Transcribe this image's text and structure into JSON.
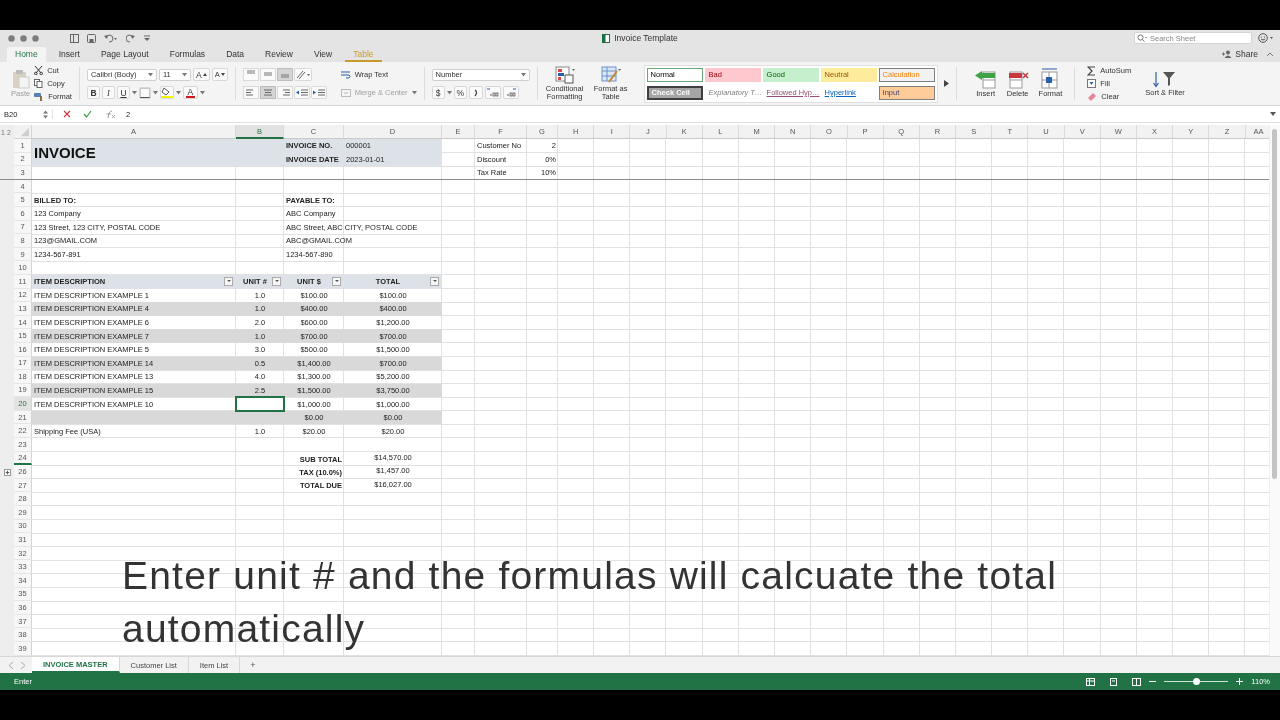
{
  "window": {
    "title": "Invoice Template",
    "search_placeholder": "Search Sheet",
    "share": "Share"
  },
  "tabs": [
    {
      "label": "Home",
      "selected": true,
      "kind": "standard"
    },
    {
      "label": "Insert",
      "selected": false,
      "kind": "standard"
    },
    {
      "label": "Page Layout",
      "selected": false,
      "kind": "standard"
    },
    {
      "label": "Formulas",
      "selected": false,
      "kind": "standard"
    },
    {
      "label": "Data",
      "selected": false,
      "kind": "standard"
    },
    {
      "label": "Review",
      "selected": false,
      "kind": "standard"
    },
    {
      "label": "View",
      "selected": false,
      "kind": "standard"
    },
    {
      "label": "Table",
      "selected": false,
      "kind": "contextual"
    }
  ],
  "ribbon": {
    "paste": {
      "label": "Paste",
      "disabled": true
    },
    "cut": "Cut",
    "copy": "Copy",
    "format_painter": "Format",
    "font": {
      "name": "Calibri (Body)",
      "size": "11",
      "grow": "A",
      "shrink": "A",
      "bold": "B",
      "italic": "I",
      "underline": "U",
      "color_letter": "A"
    },
    "vertical_align": [
      {
        "selected": false
      },
      {
        "selected": false
      },
      {
        "selected": true
      }
    ],
    "horizontal_align": [
      {
        "selected": false
      },
      {
        "selected": true
      },
      {
        "selected": false
      }
    ],
    "wrap_text": {
      "label": "Wrap Text",
      "disabled": false
    },
    "merge": {
      "label": "Merge & Center",
      "disabled": true
    },
    "number_format": "Number",
    "currency": "$",
    "percent": "%",
    "conditional_formatting": "Conditional Formatting",
    "format_as_table": "Format as Table",
    "cell_styles": [
      {
        "label": "Normal",
        "kind": "normal",
        "selected": true
      },
      {
        "label": "Bad",
        "kind": "bad",
        "selected": false
      },
      {
        "label": "Good",
        "kind": "good",
        "selected": false
      },
      {
        "label": "Neutral",
        "kind": "neutral",
        "selected": false
      },
      {
        "label": "Calculation",
        "kind": "calculation",
        "selected": false
      },
      {
        "label": "Check Cell",
        "kind": "check",
        "selected": false
      },
      {
        "label": "Explanatory T…",
        "kind": "explanatory",
        "selected": false
      },
      {
        "label": "Followed Hyp…",
        "kind": "followed",
        "selected": false
      },
      {
        "label": "Hyperlink",
        "kind": "hyperlink",
        "selected": false
      },
      {
        "label": "Input",
        "kind": "input",
        "selected": false
      }
    ],
    "cells": [
      {
        "label": "Insert",
        "kind": "insert"
      },
      {
        "label": "Delete",
        "kind": "delete"
      },
      {
        "label": "Format",
        "kind": "format"
      }
    ],
    "autosum": "AutoSum",
    "fill": "Fill",
    "clear": "Clear",
    "sort_filter": "Sort & Filter"
  },
  "formula_bar": {
    "name_box": "B20",
    "formula": "2"
  },
  "sheet": {
    "outline_levels": [
      "1",
      "2"
    ],
    "columns": [
      "A",
      "B",
      "C",
      "D",
      "E",
      "F",
      "G",
      "H",
      "I",
      "J",
      "K",
      "L",
      "M",
      "N",
      "O",
      "P",
      "Q",
      "R",
      "S",
      "T",
      "U",
      "V",
      "W",
      "X",
      "Y",
      "Z",
      "AA"
    ],
    "row_numbers": [
      "1",
      "2",
      "3",
      "4",
      "5",
      "6",
      "7",
      "8",
      "9",
      "10",
      "11",
      "12",
      "13",
      "14",
      "15",
      "16",
      "17",
      "18",
      "19",
      "20",
      "21",
      "22",
      "23",
      "24",
      "26",
      "27",
      "28",
      "29",
      "30",
      "31",
      "32",
      "33",
      "34",
      "35",
      "36",
      "37",
      "38",
      "39"
    ],
    "header": {
      "title": "INVOICE",
      "fields": [
        {
          "label": "INVOICE NO.",
          "value": "000001"
        },
        {
          "label": "INVOICE DATE",
          "value": "2023-01-01"
        }
      ]
    },
    "billed_to": {
      "label": "BILLED TO:",
      "lines": [
        "123 Company",
        "123 Street, 123 CITY, POSTAL CODE",
        "123@GMAIL.COM",
        "1234-567-891"
      ]
    },
    "payable_to": {
      "label": "PAYABLE TO:",
      "lines": [
        "ABC Company",
        "ABC Street,  ABC CITY, POSTAL CODE",
        "ABC@GMAIL.COM",
        "1234-567-890"
      ]
    },
    "items": {
      "columns": [
        {
          "label": "ITEM DESCRIPTION"
        },
        {
          "label": "UNIT #"
        },
        {
          "label": "UNIT $"
        },
        {
          "label": "TOTAL"
        }
      ],
      "rows": [
        {
          "description": "ITEM DESCRIPTION EXAMPLE 1",
          "units": "1.0",
          "unit_price": "$100.00",
          "total": "$100.00",
          "selected": false
        },
        {
          "description": "ITEM DESCRIPTION EXAMPLE 4",
          "units": "1.0",
          "unit_price": "$400.00",
          "total": "$400.00",
          "selected": false
        },
        {
          "description": "ITEM DESCRIPTION EXAMPLE 6",
          "units": "2.0",
          "unit_price": "$600.00",
          "total": "$1,200.00",
          "selected": false
        },
        {
          "description": "ITEM DESCRIPTION EXAMPLE 7",
          "units": "1.0",
          "unit_price": "$700.00",
          "total": "$700.00",
          "selected": false
        },
        {
          "description": "ITEM DESCRIPTION EXAMPLE 5",
          "units": "3.0",
          "unit_price": "$500.00",
          "total": "$1,500.00",
          "selected": false
        },
        {
          "description": "ITEM DESCRIPTION EXAMPLE 14",
          "units": "0.5",
          "unit_price": "$1,400.00",
          "total": "$700.00",
          "selected": false
        },
        {
          "description": "ITEM DESCRIPTION EXAMPLE 13",
          "units": "4.0",
          "unit_price": "$1,300.00",
          "total": "$5,200.00",
          "selected": false
        },
        {
          "description": "ITEM DESCRIPTION EXAMPLE 15",
          "units": "2.5",
          "unit_price": "$1,500.00",
          "total": "$3,750.00",
          "selected": false
        },
        {
          "description": "ITEM DESCRIPTION EXAMPLE 10",
          "unit_price": "$1,000.00",
          "total": "$1,000.00",
          "selected": true
        },
        {
          "unit_price": "$0.00",
          "total": "$0.00",
          "selected": false
        },
        {
          "description": "Shipping Fee (USA)",
          "units": "1.0",
          "unit_price": "$20.00",
          "total": "$20.00",
          "selected": false
        }
      ]
    },
    "totals": [
      {
        "label": "SUB TOTAL",
        "value": "$14,570.00"
      },
      {
        "label": "TAX (10.0%)",
        "value": "$1,457.00"
      },
      {
        "label": "TOTAL DUE",
        "value": "$16,027.00"
      }
    ],
    "settings": [
      {
        "label": "Customer No",
        "value": "2"
      },
      {
        "label": "Discount",
        "value": "0%"
      },
      {
        "label": "Tax Rate",
        "value": "10%"
      }
    ]
  },
  "caption": "Enter unit # and the formulas will calcuate the total automatically",
  "sheet_tabs": [
    {
      "label": "INVOICE MASTER",
      "selected": true
    },
    {
      "label": "Customer List",
      "selected": false
    },
    {
      "label": "Item List",
      "selected": false
    }
  ],
  "add_sheet": "+",
  "status_bar": {
    "mode": "Enter",
    "zoom": "110%",
    "zoom_slider": {
      "level": 0.5
    }
  }
}
